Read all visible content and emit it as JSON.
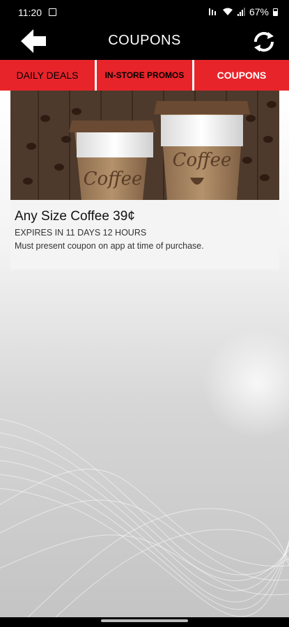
{
  "status_bar": {
    "time": "11:20",
    "battery": "67%",
    "icons": [
      "image-icon",
      "mute-icon",
      "wifi-icon",
      "signal-icon",
      "battery-icon"
    ]
  },
  "header": {
    "title": "COUPONS",
    "back_icon": "back-arrow-icon",
    "refresh_icon": "refresh-icon"
  },
  "tabs": [
    {
      "label": "DAILY DEALS",
      "active": false
    },
    {
      "label": "IN-STORE PROMOS",
      "active": false
    },
    {
      "label": "COUPONS",
      "active": true
    }
  ],
  "coupons": [
    {
      "image_cup_text": "Coffee",
      "title": "Any Size Coffee 39¢",
      "expires": "EXPIRES IN 11 DAYS 12 HOURS",
      "note": "Must present coupon on app at time of purchase."
    }
  ],
  "colors": {
    "accent_red": "#e8242b",
    "header_black": "#000000"
  }
}
